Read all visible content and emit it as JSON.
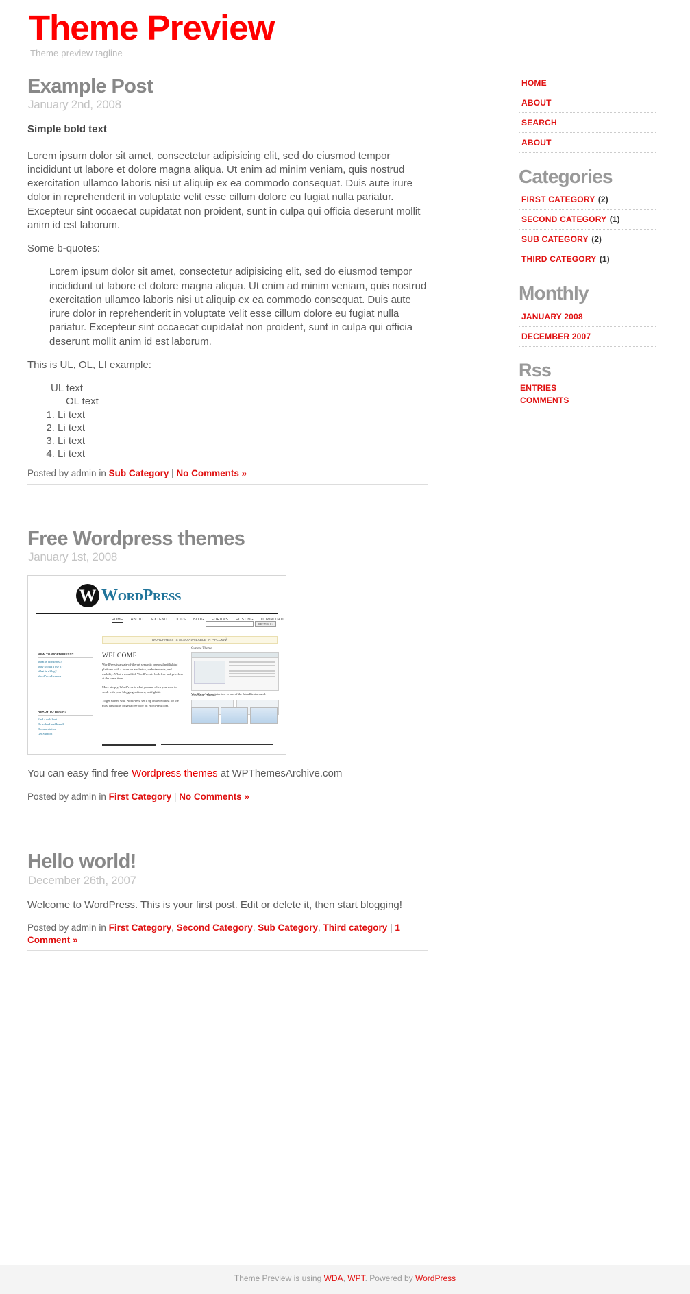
{
  "header": {
    "blog_title": "Theme Preview",
    "tagline": "Theme preview tagline"
  },
  "colors": {
    "link_red": "#e01111",
    "title_red": "#ff0000",
    "heading_gray": "#888888",
    "date_gray": "#c3c3c3",
    "body_gray": "#5a5a5a"
  },
  "posts": [
    {
      "title": "Example Post",
      "date": "January 2nd, 2008",
      "bold_lead": "Simple bold text",
      "paragraph_1": "Lorem ipsum dolor sit amet, consectetur adipisicing elit, sed do eiusmod tempor incididunt ut labore et dolore magna aliqua. Ut enim ad minim veniam, quis nostrud exercitation ullamco laboris nisi ut aliquip ex ea commodo consequat. Duis aute irure dolor in reprehenderit in voluptate velit esse cillum dolore eu fugiat nulla pariatur. Excepteur sint occaecat cupidatat non proident, sunt in culpa qui officia deserunt mollit anim id est laborum.",
      "quote_intro": "Some b-quotes:",
      "blockquote": "Lorem ipsum dolor sit amet, consectetur adipisicing elit, sed do eiusmod tempor incididunt ut labore et dolore magna aliqua. Ut enim ad minim veniam, quis nostrud exercitation ullamco laboris nisi ut aliquip ex ea commodo consequat. Duis aute irure dolor in reprehenderit in voluptate velit esse cillum dolore eu fugiat nulla pariatur. Excepteur sint occaecat cupidatat non proident, sunt in culpa qui officia deserunt mollit anim id est laborum.",
      "list_intro": "This is UL, OL, LI example:",
      "ul_text": "UL text",
      "ol_text": "OL text",
      "li_items": [
        "Li text",
        "Li text",
        "Li text",
        "Li text"
      ],
      "meta": {
        "posted_by": "Posted by admin",
        "in_word": "in",
        "categories": [
          "Sub Category"
        ],
        "separator": "|",
        "comments": "No Comments »"
      }
    },
    {
      "title": "Free Wordpress themes",
      "date": "January 1st, 2008",
      "caption_before": "You can easy find free ",
      "caption_link": "Wordpress themes",
      "caption_after": " at WPThemesArchive.com",
      "meta": {
        "posted_by": "Posted by admin",
        "in_word": "in",
        "categories": [
          "First Category"
        ],
        "separator": "|",
        "comments": "No Comments »"
      }
    },
    {
      "title": "Hello world!",
      "date": "December 26th, 2007",
      "paragraph_1": "Welcome to WordPress. This is your first post. Edit or delete it, then start blogging!",
      "meta": {
        "posted_by": "Posted by admin",
        "in_word": "in",
        "categories": [
          "First Category",
          "Second Category",
          "Sub Category",
          "Third category"
        ],
        "separator": "|",
        "comments": "1 Comment »"
      }
    }
  ],
  "screenshot_image": {
    "wp_logo_letter": "W",
    "wp_wordmark": "WordPress",
    "nav": [
      "HOME",
      "ABOUT",
      "EXTEND",
      "DOCS",
      "BLOG",
      "FORUMS",
      "HOSTING",
      "DOWNLOAD"
    ],
    "search_button": "SEARCH »",
    "notice": "WORDPRESS IS ALSO AVAILABLE IN РУССКИЙ",
    "welcome_heading": "WELCOME",
    "welcome_p1": "WordPress is a state-of-the-art semantic personal publishing platform with a focus on aesthetics, web standards, and usability. What a mouthful. WordPress is both free and priceless at the same time.",
    "welcome_p2": "More simply, WordPress is what you use when you want to work with your blogging software, not fight it.",
    "welcome_p3": "To get started with WordPress, set it up on a web host for the most flexibility or get a free blog on WordPress.com.",
    "left_head_1": "NEW TO WORDPRESS?",
    "left_links_1": [
      "What is WordPress?",
      "Why should I use it?",
      "What is a blog?",
      "WordPress Lessons"
    ],
    "left_head_2": "READY TO BEGIN?",
    "left_links_2": [
      "Find a web host",
      "Download and Install",
      "Documentation",
      "Get Support"
    ],
    "right_panel_label": "Current Theme",
    "right_avail_label": "Available Themes",
    "right_caption": "WordPress' admin interface is one of the friendliest around."
  },
  "sidebar": {
    "nav": [
      {
        "label": "HOME"
      },
      {
        "label": "ABOUT"
      },
      {
        "label": "SEARCH"
      },
      {
        "label": "ABOUT"
      }
    ],
    "categories_heading": "Categories",
    "categories": [
      {
        "label": "FIRST CATEGORY",
        "count": "(2)"
      },
      {
        "label": "SECOND CATEGORY",
        "count": "(1)"
      },
      {
        "label": "SUB CATEGORY",
        "count": "(2)"
      },
      {
        "label": "THIRD CATEGORY",
        "count": "(1)"
      }
    ],
    "monthly_heading": "Monthly",
    "monthly": [
      {
        "label": "JANUARY 2008"
      },
      {
        "label": "DECEMBER 2007"
      }
    ],
    "rss_heading": "Rss",
    "rss": [
      {
        "label": "ENTRIES"
      },
      {
        "label": "COMMENTS"
      }
    ]
  },
  "footer": {
    "prefix": "Theme Preview is using ",
    "link1": "WDA",
    "mid1": ", ",
    "link2": "WPT",
    "mid2": ". Powered by ",
    "link3": "WordPress"
  }
}
